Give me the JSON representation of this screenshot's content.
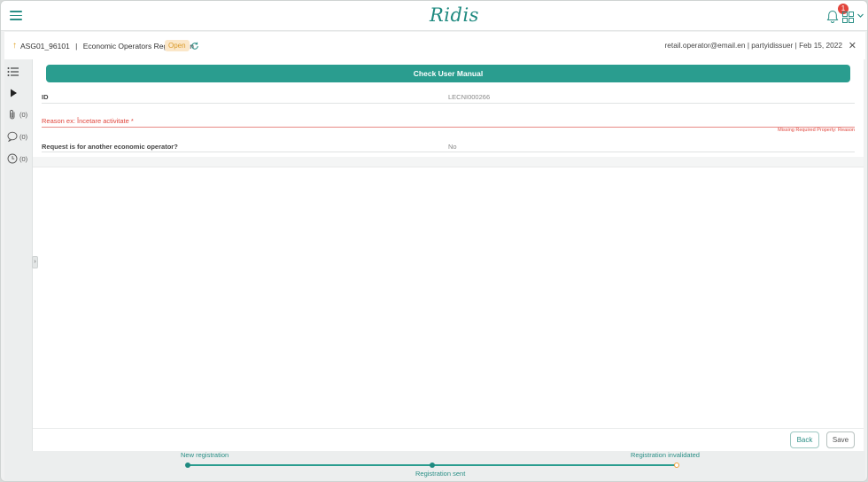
{
  "header": {
    "logo_text": "Ridis",
    "notification_count": "1"
  },
  "breadcrumb": {
    "record_id": "ASG01_96101",
    "separator": "|",
    "process_name": "Economic Operators Registration",
    "status": "Open",
    "user_info": "retail.operator@email.en | partyidissuer | Feb 15, 2022"
  },
  "rail": {
    "attachments_count": "(0)",
    "comments_count": "(0)",
    "history_count": "(0)"
  },
  "form": {
    "manual_button": "Check User Manual",
    "id_label": "ID",
    "id_value": "LECNI000266",
    "reason_label": "Reason ex: Încetare activitate *",
    "reason_error": "Missing Required Property: Reason",
    "other_operator_label": "Request is for another economic operator?",
    "other_operator_value": "No"
  },
  "actions": {
    "back_label": "Back",
    "save_label": "Save"
  },
  "progress": {
    "steps": [
      {
        "label": "New registration",
        "state": "done"
      },
      {
        "label": "Registration sent",
        "state": "current"
      },
      {
        "label": "Registration invalidated",
        "state": "pending"
      }
    ]
  },
  "colors": {
    "accent": "#2a9d8f",
    "error": "#e0463d",
    "status_open": "#d99a2b",
    "badge": "#e2453c",
    "pending_step": "#f0a23a"
  }
}
